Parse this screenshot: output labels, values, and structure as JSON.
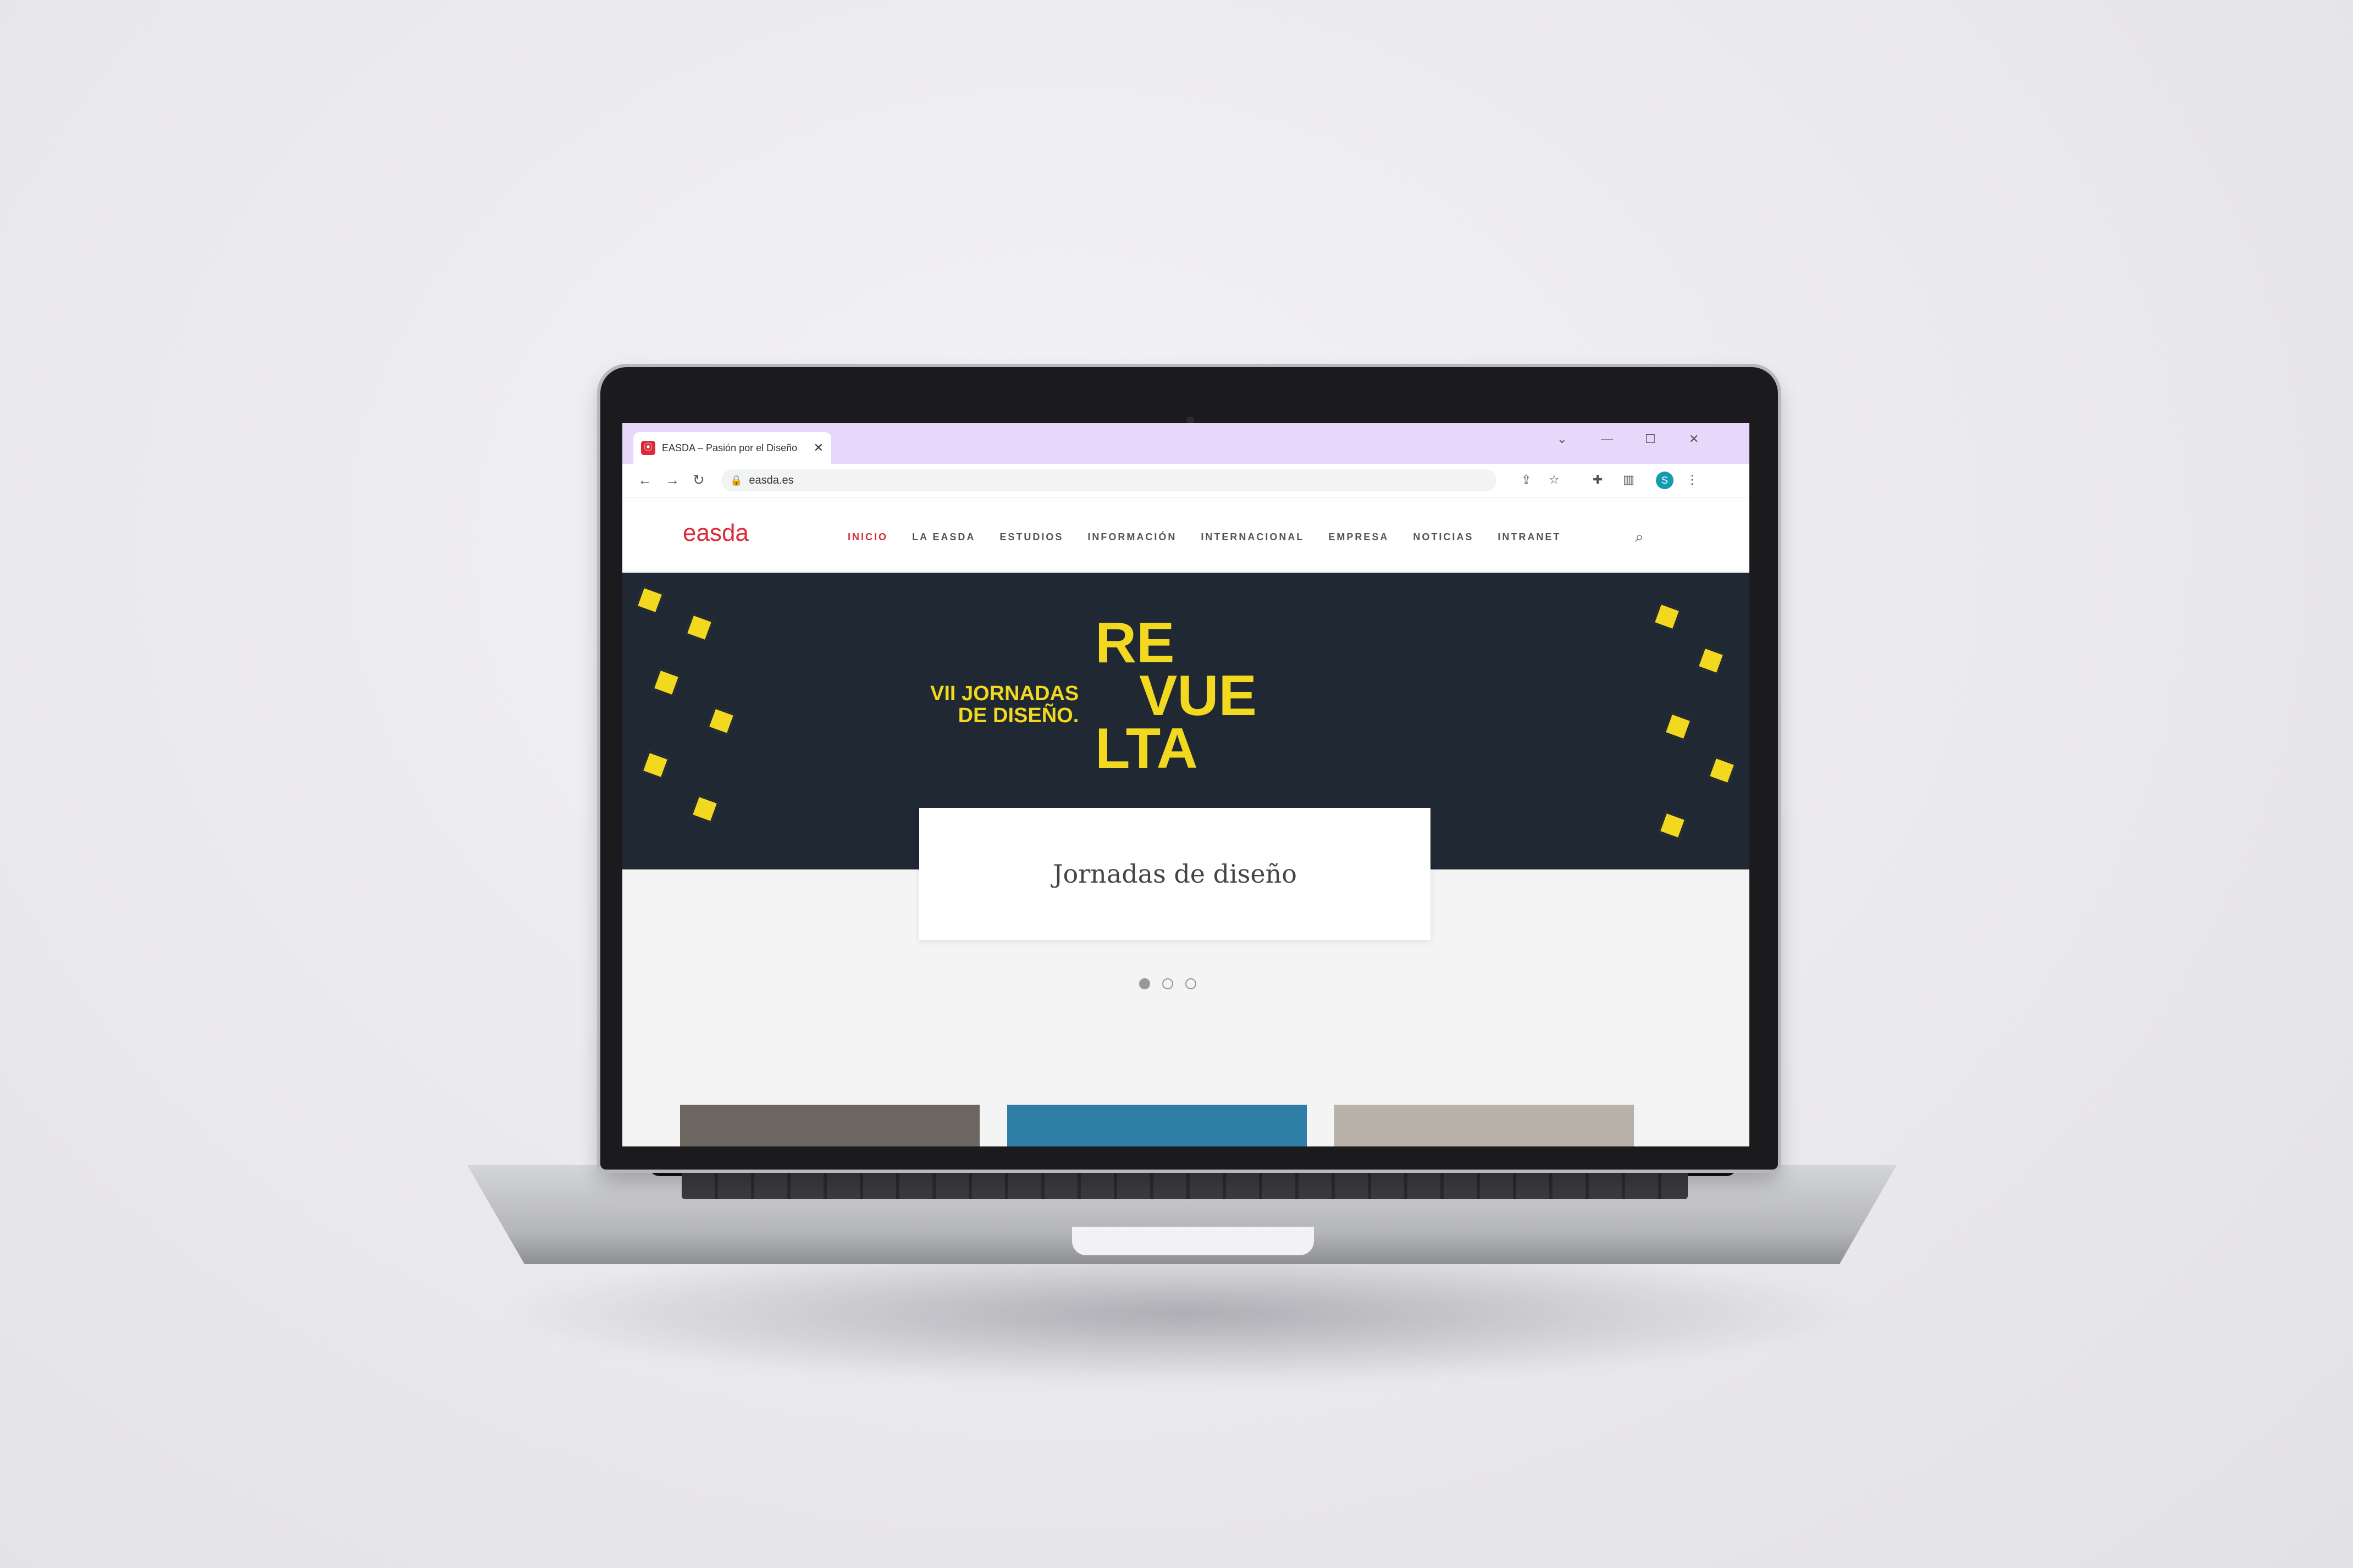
{
  "browser": {
    "tab_title": "EASDA – Pasión por el Diseño",
    "favicon_glyph": "⦿",
    "tab_close": "✕",
    "url": "easda.es",
    "profile_initial": "S",
    "controls": {
      "minimize": "—",
      "maximize": "☐",
      "close": "✕",
      "dropdown": "⌄"
    },
    "nav": {
      "back": "←",
      "forward": "→",
      "reload": "↻"
    },
    "toolbar_icons": {
      "lock": "🔒",
      "share": "⇪",
      "star": "☆",
      "extensions": "✚",
      "sidepanel": "▥",
      "menu": "⋮"
    }
  },
  "site": {
    "logo": "easda",
    "nav_items": [
      "INICIO",
      "LA EASDA",
      "ESTUDIOS",
      "INFORMACIÓN",
      "INTERNACIONAL",
      "EMPRESA",
      "NOTICIAS",
      "INTRANET"
    ],
    "active_nav": "INICIO",
    "search_icon": "⌕",
    "hero": {
      "line1": "VII JORNADAS",
      "line2": "DE DISEÑO.",
      "big1": "RE",
      "big2": "VUE",
      "big3": "LTA",
      "accent_color": "#f2d81e",
      "bg_color": "#1f2833"
    },
    "slide_caption": "Jornadas de diseño",
    "slider_dots": 3,
    "active_dot": 0
  },
  "colors": {
    "brand_red": "#d92b3a",
    "tabbar": "#e7d7fb"
  }
}
